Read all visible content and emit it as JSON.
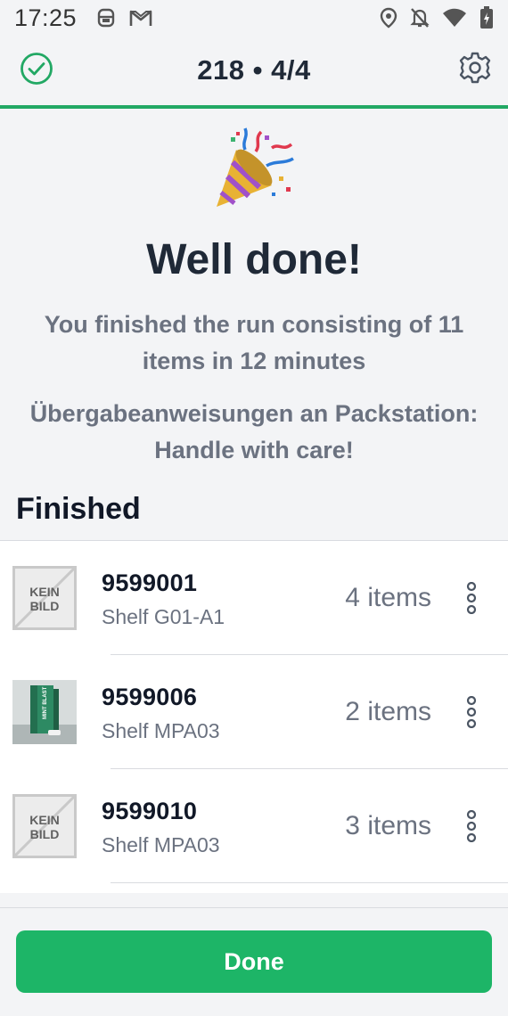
{
  "status_bar": {
    "time": "17:25",
    "icons": [
      "signal-assistant-icon",
      "gmail-icon",
      "location-icon",
      "notifications-off-icon",
      "wifi-icon",
      "battery-charging-icon"
    ]
  },
  "header": {
    "title": "218 • 4/4",
    "left_icon": "check-circle-icon",
    "right_icon": "gear-icon"
  },
  "hero": {
    "icon": "party-popper-icon",
    "title": "Well done!",
    "summary": "You finished the run consisting of 11 items in 12 minutes",
    "instructions": "Übergabeanweisungen an Packstation: Handle with care!"
  },
  "finished": {
    "heading": "Finished",
    "items": [
      {
        "sku": "9599001",
        "location": "Shelf G01-A1",
        "quantity": "4 items",
        "image": "kein-bild",
        "placeholder_text": "KEIN BILD"
      },
      {
        "sku": "9599006",
        "location": "Shelf MPA03",
        "quantity": "2 items",
        "image": "product-photo",
        "placeholder_text": ""
      },
      {
        "sku": "9599010",
        "location": "Shelf MPA03",
        "quantity": "3 items",
        "image": "kein-bild",
        "placeholder_text": "KEIN BILD"
      }
    ]
  },
  "footer": {
    "done_label": "Done"
  },
  "colors": {
    "accent_green": "#1db567",
    "header_line": "#22a864",
    "background": "#f3f4f6",
    "muted_text": "#6b7280"
  }
}
